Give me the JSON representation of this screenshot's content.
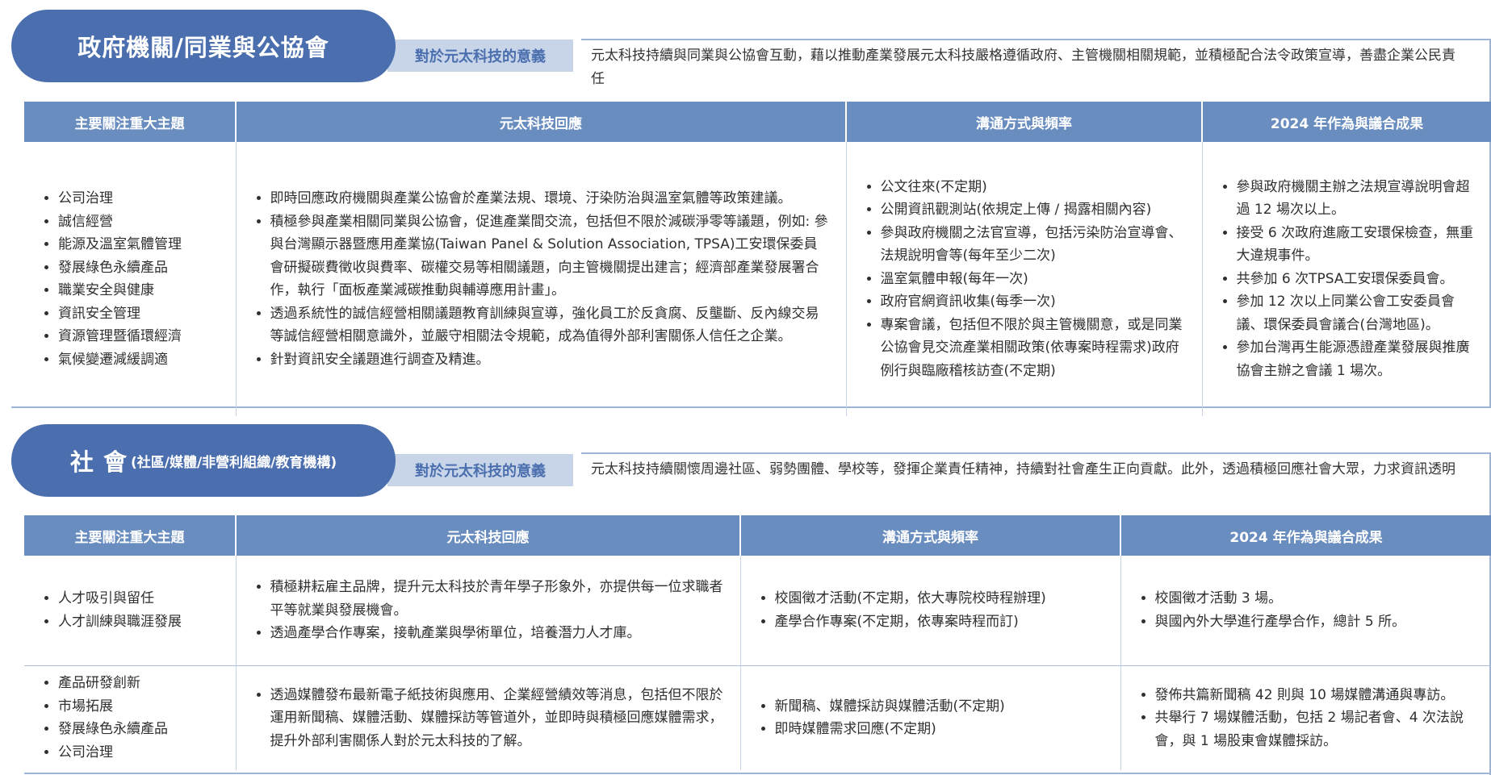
{
  "section_gov": {
    "title": "政府機關/同業與公協會",
    "meaning_tag": "對於元太科技的意義",
    "meaning_text": "元太科技持續與同業與公協會互動，藉以推動產業發展元太科技嚴格遵循政府、主管機關相關規範，並積極配合法令政策宣導，善盡企業公民責任",
    "headers": [
      "主要關注重大主題",
      "元太科技回應",
      "溝通方式與頻率",
      "2024 年作為與議合成果"
    ],
    "rows": [
      {
        "topics": [
          "公司治理",
          "誠信經營",
          "能源及溫室氣體管理",
          "發展綠色永續產品",
          "職業安全與健康",
          "資訊安全管理",
          "資源管理暨循環經濟",
          "氣候變遷減緩調適"
        ],
        "responses": [
          "即時回應政府機關與產業公協會於產業法規、環境、汙染防治與溫室氣體等政策建議。",
          "積極參與產業相關同業與公協會，促進產業間交流，包括但不限於減碳淨零等議題，例如: 參與台灣顯示器暨應用產業協(Taiwan Panel & Solution Association, TPSA)工安環保委員會研擬碳費徵收與費率、碳權交易等相關議題，向主管機關提出建言；經濟部產業發展署合作，執行「面板產業減碳推動與輔導應用計畫」。",
          "透過系統性的誠信經營相關議題教育訓練與宣導，強化員工於反貪腐、反壟斷、反內線交易等誠信經營相關意識外，並嚴守相關法令規範，成為值得外部利害關係人信任之企業。",
          "針對資訊安全議題進行調查及精進。"
        ],
        "channels": [
          "公文往來(不定期)",
          "公開資訊觀測站(依規定上傳 / 揭露相關內容)",
          "參與政府機關之法官宣導，包括污染防治宣導會、法規說明會等(每年至少二次)",
          "溫室氣體申報(每年一次)",
          "政府官網資訊收集(每季一次)",
          "專案會議，包括但不限於與主管機關意，或是同業公協會見交流產業相關政策(依專案時程需求)政府例行與臨廠稽核訪查(不定期)"
        ],
        "results": [
          "參與政府機關主辦之法規宣導說明會超過 12 場次以上。",
          "接受 6 次政府進廠工安環保檢查，無重大違規事件。",
          "共參加 6 次TPSA工安環保委員會。",
          "參加 12 次以上同業公會工安委員會議、環保委員會議合(台灣地區)。",
          "參加台灣再生能源憑證產業發展與推廣協會主辦之會議 1 場次。"
        ]
      }
    ]
  },
  "section_soc": {
    "title_big": "社 會",
    "title_small": "(社區/媒體/非營利組織/教育機構)",
    "meaning_tag": "對於元太科技的意義",
    "meaning_text": "元太科技持續關懷周邊社區、弱勢團體、學校等，發揮企業責任精神，持續對社會產生正向貢獻。此外，透過積極回應社會大眾，力求資訊透明",
    "headers": [
      "主要關注重大主題",
      "元太科技回應",
      "溝通方式與頻率",
      "2024 年作為與議合成果"
    ],
    "rows": [
      {
        "topics": [
          "人才吸引與留任",
          "人才訓練與職涯發展"
        ],
        "responses": [
          "積極耕耘雇主品牌，提升元太科技於青年學子形象外，亦提供每一位求職者平等就業與發展機會。",
          "透過產學合作專案，接軌產業與學術單位，培養潛力人才庫。"
        ],
        "channels": [
          "校園徵才活動(不定期，依大專院校時程辦理)",
          "產學合作專案(不定期，依專案時程而訂)"
        ],
        "results": [
          "校園徵才活動 3 場。",
          "與國內外大學進行產學合作，總計 5 所。"
        ]
      },
      {
        "topics": [
          "產品研發創新",
          "市場拓展",
          "發展綠色永續產品",
          "公司治理"
        ],
        "responses": [
          "透過媒體發布最新電子紙技術與應用、企業經營績效等消息，包括但不限於運用新聞稿、媒體活動、媒體採訪等管道外，並即時與積極回應媒體需求，提升外部利害關係人對於元太科技的了解。"
        ],
        "channels": [
          "新聞稿、媒體採訪與媒體活動(不定期)",
          "即時媒體需求回應(不定期)"
        ],
        "results": [
          "發佈共篇新聞稿 42 則與 10 場媒體溝通與專訪。",
          "共舉行 7 場媒體活動，包括 2 場記者會、4 次法說會，與 1 場股東會媒體採訪。"
        ]
      }
    ]
  }
}
